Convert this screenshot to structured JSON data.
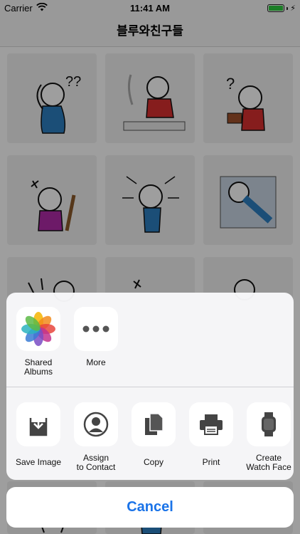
{
  "status_bar": {
    "carrier": "Carrier",
    "time": "11:41 AM",
    "battery_level": 1.0,
    "battery_color": "#2ecc40"
  },
  "nav": {
    "title": "블루와친구들"
  },
  "share_sheet": {
    "apps": [
      {
        "label": "Shared\nAlbums",
        "icon": "photos-icon"
      },
      {
        "label": "More",
        "icon": "more-icon"
      }
    ],
    "actions": [
      {
        "label": "Save Image",
        "icon": "save-image-icon"
      },
      {
        "label": "Assign\nto Contact",
        "icon": "contact-icon"
      },
      {
        "label": "Copy",
        "icon": "copy-icon"
      },
      {
        "label": "Print",
        "icon": "print-icon"
      },
      {
        "label": "Create\nWatch Face",
        "icon": "watch-icon"
      }
    ],
    "cancel": "Cancel"
  },
  "colors": {
    "accent": "#1a73e8",
    "shirt_blue": "#2d7fc1",
    "shirt_red": "#d93030",
    "shirt_magenta": "#b02aa8"
  }
}
